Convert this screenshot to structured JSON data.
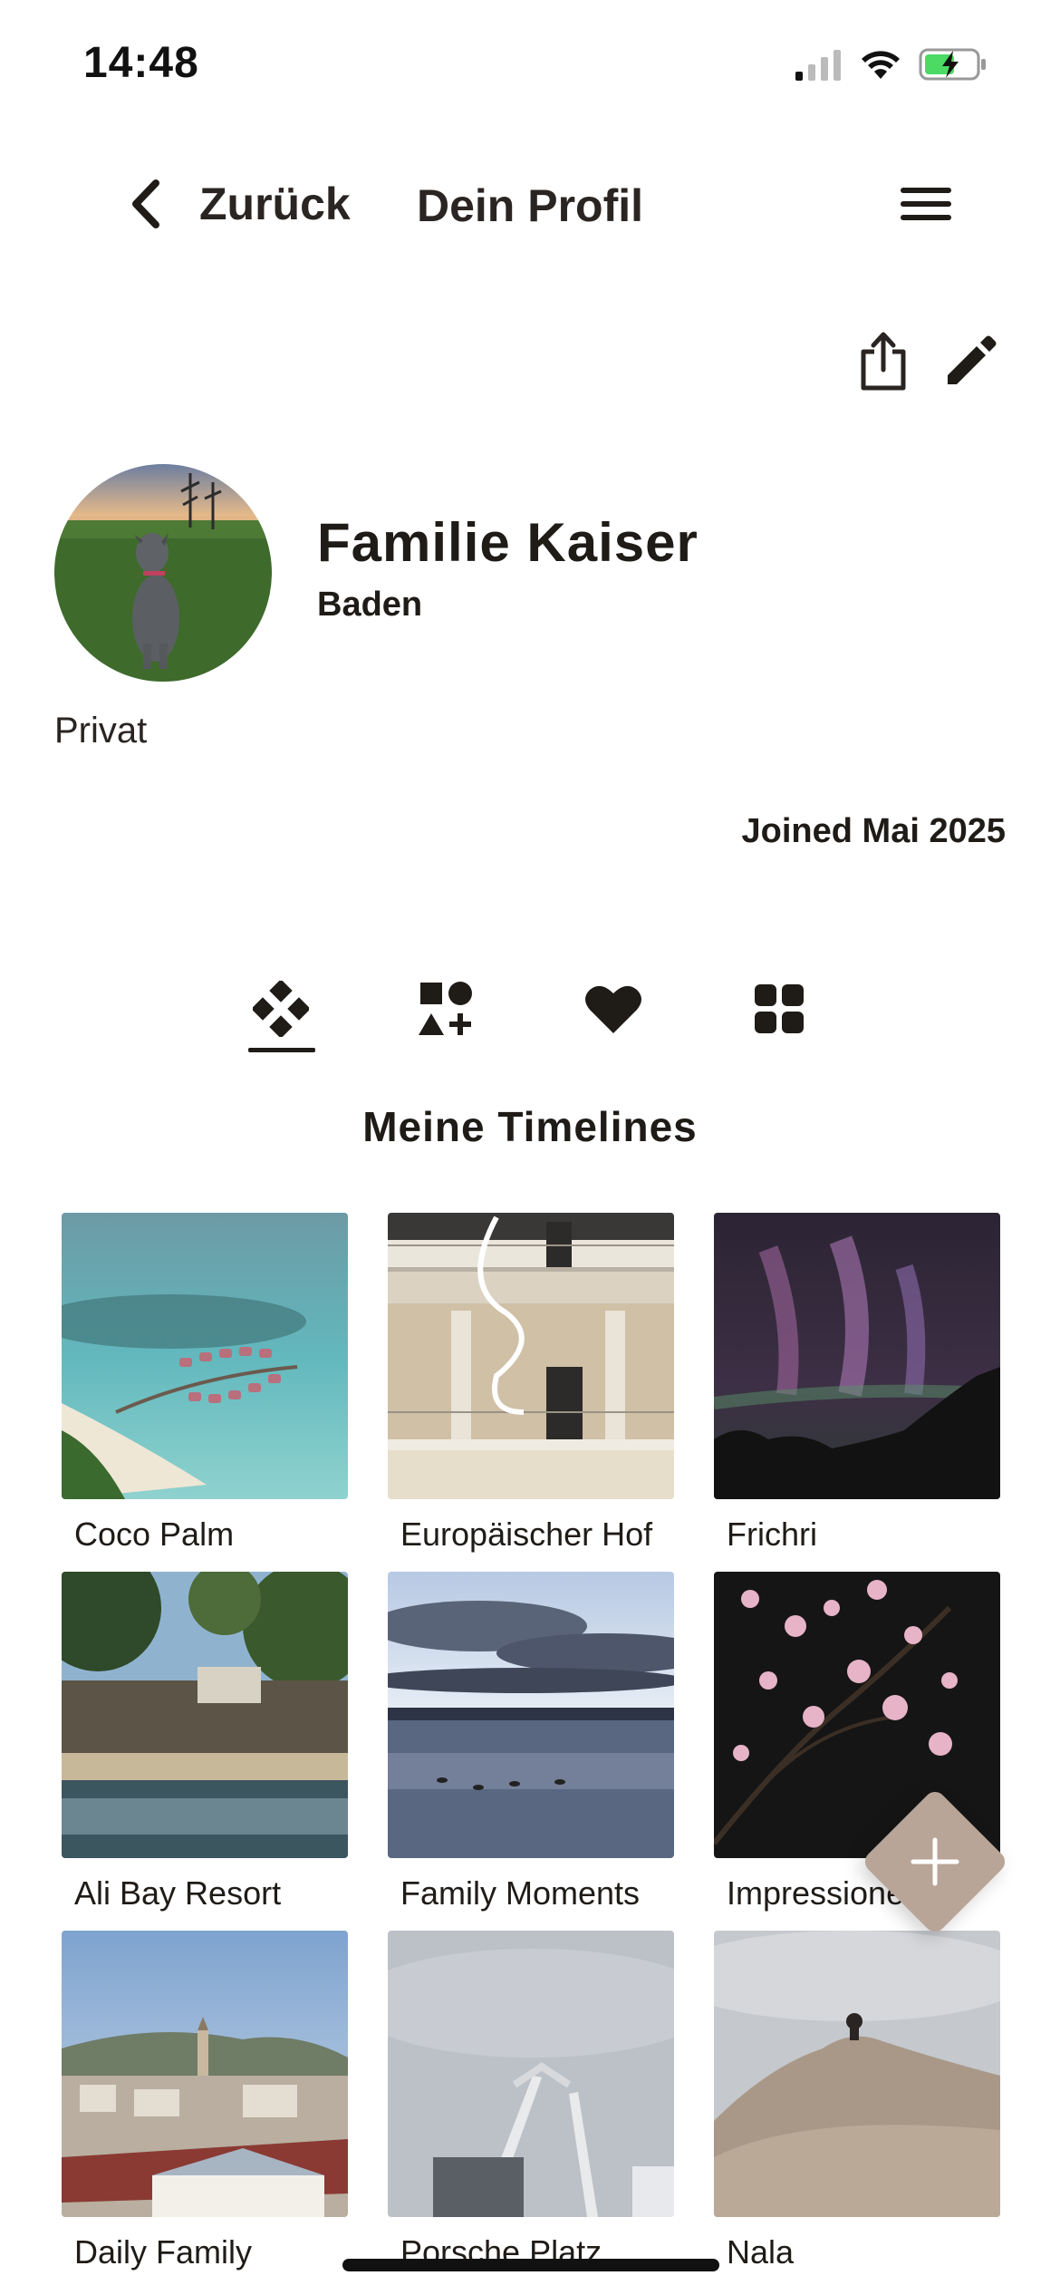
{
  "status_bar": {
    "time": "14:48"
  },
  "nav": {
    "back_label": "Zurück",
    "title": "Dein Profil"
  },
  "profile": {
    "name": "Familie Kaiser",
    "location": "Baden",
    "privacy": "Privat",
    "joined": "Joined Mai 2025"
  },
  "tabs": [
    {
      "icon": "diamond-grid-icon",
      "active": true
    },
    {
      "icon": "shapes-add-icon",
      "active": false
    },
    {
      "icon": "heart-icon",
      "active": false
    },
    {
      "icon": "grid-icon",
      "active": false
    }
  ],
  "section": {
    "title": "Meine Timelines"
  },
  "timelines": [
    {
      "label": "Coco Palm"
    },
    {
      "label": "Europäischer Hof"
    },
    {
      "label": "Frichri"
    },
    {
      "label": "Ali Bay Resort"
    },
    {
      "label": "Family Moments"
    },
    {
      "label": "Impressionen"
    },
    {
      "label": "Daily Family"
    },
    {
      "label": "Porsche Platz"
    },
    {
      "label": "Nala"
    }
  ],
  "colors": {
    "accent": "#b8a597",
    "text": "#1f1b17"
  }
}
